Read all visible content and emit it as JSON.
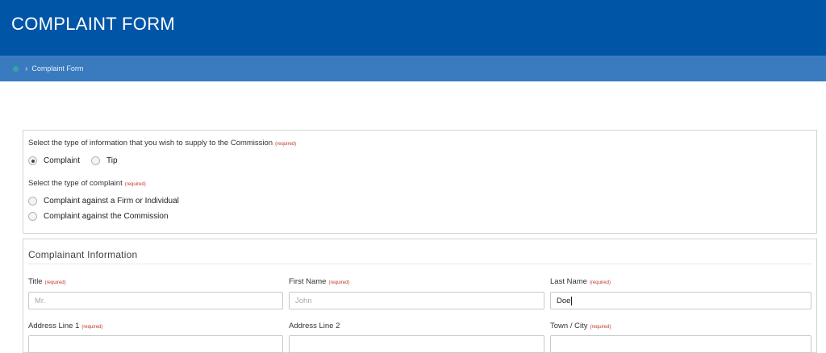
{
  "header": {
    "title": "COMPLAINT FORM"
  },
  "breadcrumb": {
    "separator": "›",
    "current": "Complaint Form"
  },
  "required_label": "(required)",
  "info_type": {
    "question": "Select the type of information that you wish to supply to the Commission",
    "options": [
      {
        "label": "Complaint",
        "checked": true
      },
      {
        "label": "Tip",
        "checked": false
      }
    ]
  },
  "complaint_type": {
    "question": "Select the type of complaint",
    "options": [
      {
        "label": "Complaint against a Firm or Individual",
        "checked": false
      },
      {
        "label": "Complaint against the Commission",
        "checked": false
      }
    ]
  },
  "complainant": {
    "section_title": "Complainant Information",
    "title_field": {
      "label": "Title",
      "placeholder": "Mr.",
      "value": ""
    },
    "first_name": {
      "label": "First Name",
      "placeholder": "John",
      "value": ""
    },
    "last_name": {
      "label": "Last Name",
      "placeholder": "",
      "value": "Doe"
    },
    "address_line_1": {
      "label": "Address Line 1"
    },
    "address_line_2": {
      "label": "Address Line 2"
    },
    "town_city": {
      "label": "Town / City"
    }
  }
}
